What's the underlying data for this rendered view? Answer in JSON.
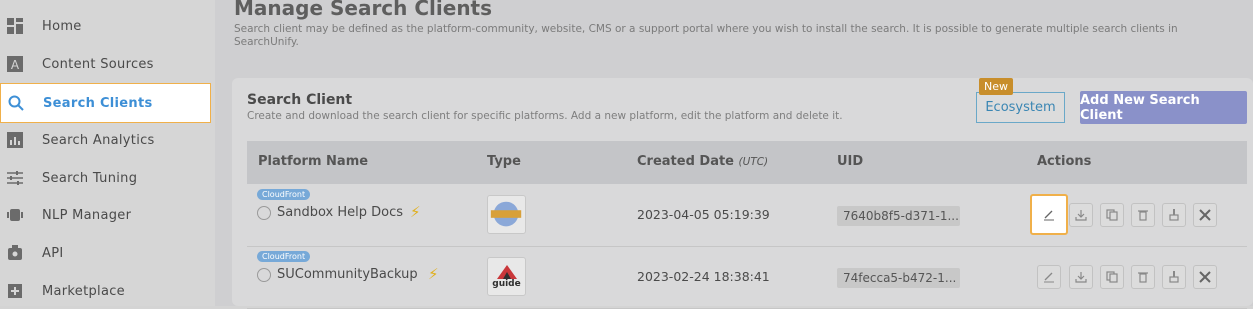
{
  "sidebar": {
    "items": [
      {
        "label": "Home",
        "icon": "home-icon"
      },
      {
        "label": "Content Sources",
        "icon": "content-sources-icon"
      },
      {
        "label": "Search Clients",
        "icon": "search-icon",
        "active": true
      },
      {
        "label": "Search Analytics",
        "icon": "analytics-icon"
      },
      {
        "label": "Search Tuning",
        "icon": "tuning-icon"
      },
      {
        "label": "NLP Manager",
        "icon": "nlp-icon"
      },
      {
        "label": "API",
        "icon": "api-icon"
      },
      {
        "label": "Marketplace",
        "icon": "marketplace-icon"
      }
    ]
  },
  "page": {
    "title": "Manage Search Clients",
    "description": "Search client may be defined as the platform-community, website, CMS or a support portal where you wish to install the search. It is possible to generate multiple search clients in SearchUnify."
  },
  "card": {
    "title": "Search Client",
    "description": "Create and download the search client for specific platforms. Add a new platform, edit the platform and delete it.",
    "new_badge": "New",
    "ecosystem_label": "Ecosystem",
    "add_label": "Add New Search Client"
  },
  "table": {
    "headers": {
      "platform": "Platform Name",
      "type": "Type",
      "created": "Created Date",
      "created_unit": "(UTC)",
      "uid": "UID",
      "actions": "Actions"
    },
    "rows": [
      {
        "tag": "CloudFront",
        "name": "Sandbox Help Docs",
        "type_icon": "globe-icon",
        "date": "2023-04-05 05:19:39",
        "uid": "7640b8f5-d371-1..."
      },
      {
        "tag": "CloudFront",
        "name": "SUCommunityBackup",
        "type_icon": "guide-icon",
        "type_label": "guide",
        "date": "2023-02-24 18:38:41",
        "uid": "74fecca5-b472-1..."
      }
    ]
  },
  "colors": {
    "accent": "#3d8fd6",
    "highlight": "#f0b04a",
    "add_button": "#8a91c9",
    "badge": "#c88e2b",
    "tag": "#77a9d8"
  }
}
